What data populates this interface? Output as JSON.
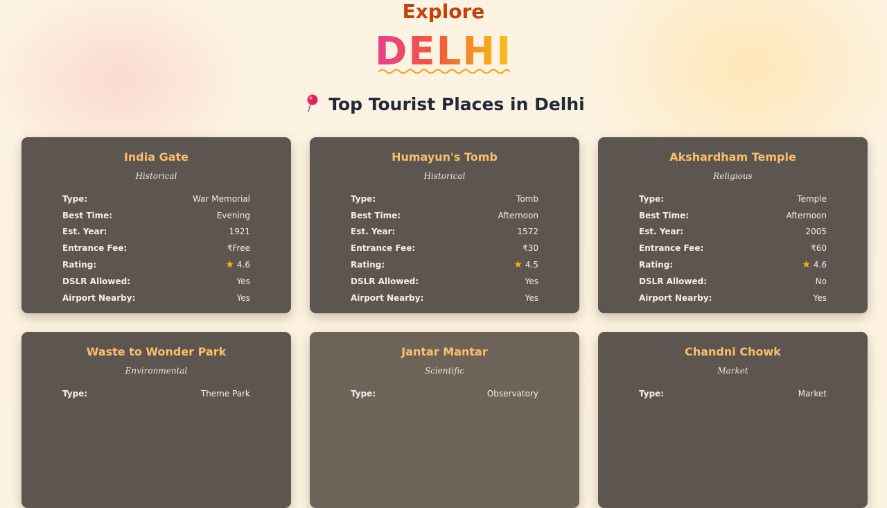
{
  "header": {
    "explore": "Explore",
    "city": "DELHI",
    "section_title": "Top Tourist Places in Delhi"
  },
  "labels": {
    "type": "Type:",
    "best_time": "Best Time:",
    "est_year": "Est. Year:",
    "entrance_fee": "Entrance Fee:",
    "rating": "Rating:",
    "dslr": "DSLR Allowed:",
    "airport": "Airport Nearby:"
  },
  "places": [
    {
      "name": "India Gate",
      "category": "Historical",
      "type": "War Memorial",
      "best_time": "Evening",
      "est_year": "1921",
      "entrance_fee": "₹Free",
      "rating": "4.6",
      "dslr": "Yes",
      "airport": "Yes"
    },
    {
      "name": "Humayun's Tomb",
      "category": "Historical",
      "type": "Tomb",
      "best_time": "Afternoon",
      "est_year": "1572",
      "entrance_fee": "₹30",
      "rating": "4.5",
      "dslr": "Yes",
      "airport": "Yes"
    },
    {
      "name": "Akshardham Temple",
      "category": "Religious",
      "type": "Temple",
      "best_time": "Afternoon",
      "est_year": "2005",
      "entrance_fee": "₹60",
      "rating": "4.6",
      "dslr": "No",
      "airport": "Yes"
    },
    {
      "name": "Waste to Wonder Park",
      "category": "Environmental",
      "type": "Theme Park"
    },
    {
      "name": "Jantar Mantar",
      "category": "Scientific",
      "type": "Observatory"
    },
    {
      "name": "Chandni Chowk",
      "category": "Market",
      "type": "Market"
    }
  ],
  "colors": {
    "accent_title": "#c2410c",
    "card_bg": "#5d5550",
    "card_title": "#fbbf6b",
    "star": "#f5b71a",
    "section_title": "#1f2937"
  },
  "icons": {
    "pin": "round-pushpin-icon",
    "star": "star-icon"
  }
}
